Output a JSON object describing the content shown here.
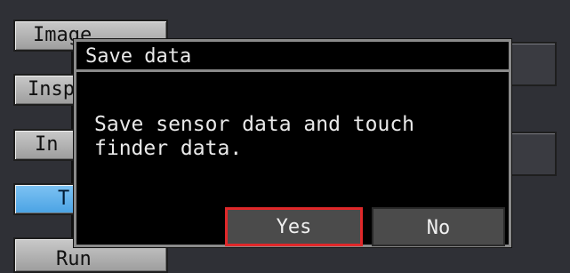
{
  "background_menu": {
    "items": [
      {
        "label": "Image",
        "state": "normal"
      },
      {
        "label": "Insp",
        "state": "normal"
      },
      {
        "label": "In",
        "state": "normal"
      },
      {
        "label": "T",
        "state": "active"
      },
      {
        "label": "Run",
        "state": "normal"
      }
    ]
  },
  "dialog": {
    "title": "Save data",
    "message": "Save sensor data and touch\nfinder data.",
    "yes_label": "Yes",
    "no_label": "No"
  },
  "colors": {
    "background": "#2f3036",
    "active_menu": "#5fb2ea",
    "selected_outline": "#e0282a"
  }
}
